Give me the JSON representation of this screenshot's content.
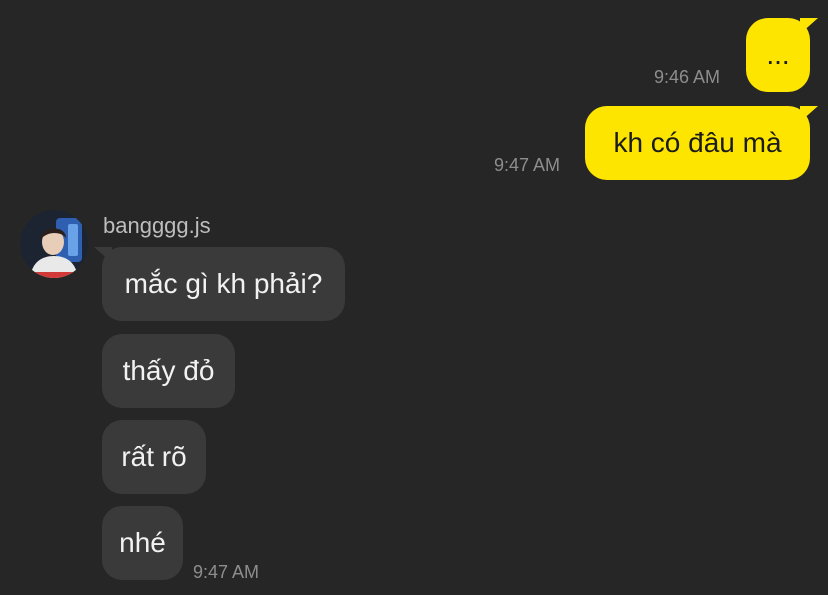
{
  "messages_out": [
    {
      "text": "...",
      "time": "9:46 AM"
    },
    {
      "text": "kh có đâu mà",
      "time": "9:47 AM"
    }
  ],
  "incoming": {
    "sender": "bangggg.js",
    "messages": [
      "mắc gì kh phải?",
      "thấy đỏ",
      "rất rõ",
      "nhé"
    ],
    "time": "9:47 AM"
  },
  "colors": {
    "background": "#262626",
    "outgoing_bubble": "#fee500",
    "incoming_bubble": "#3a3a3a",
    "timestamp": "#8d8d8d"
  }
}
